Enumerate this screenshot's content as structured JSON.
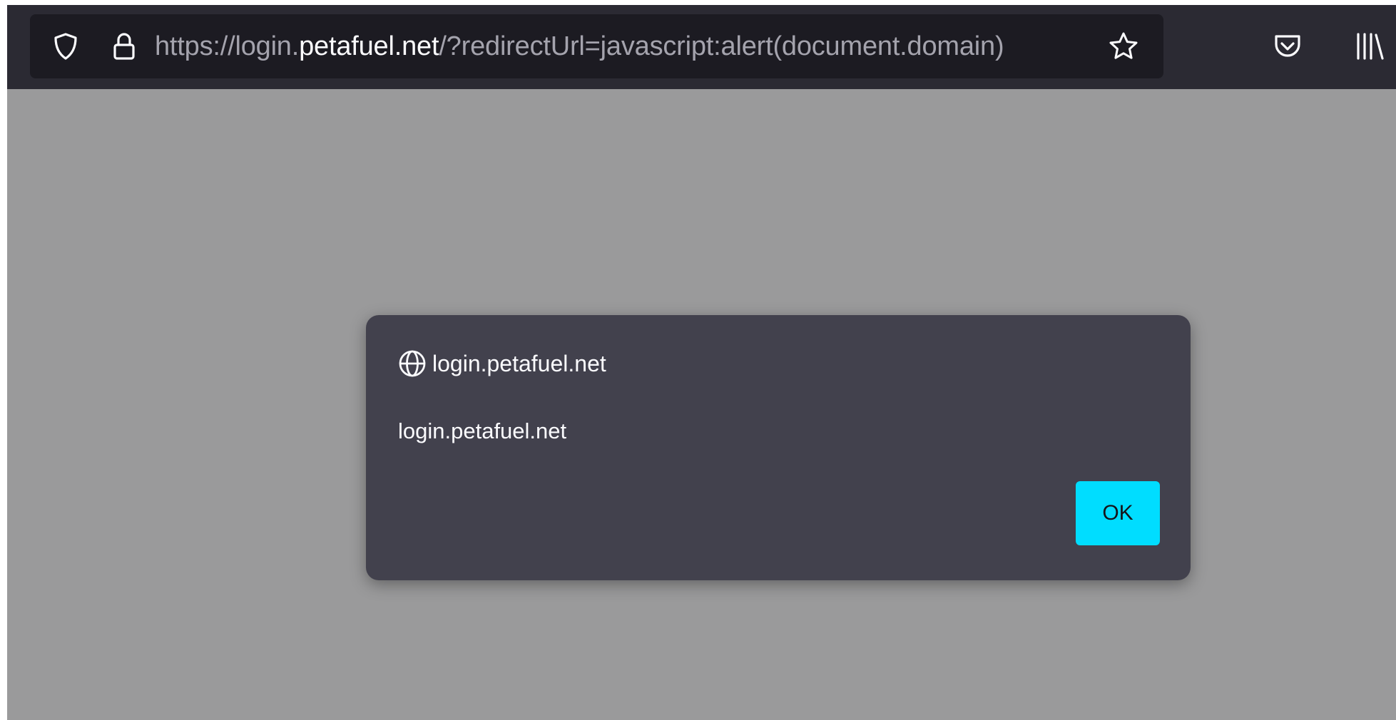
{
  "urlbar": {
    "url_prefix": "https://login.",
    "url_domain": "petafuel.net",
    "url_suffix": "/?redirectUrl=javascript:alert(document.domain)"
  },
  "icons": {
    "tracking_protection": "shield-icon",
    "connection_secure": "lock-icon",
    "bookmark": "star-icon",
    "pocket": "pocket-icon",
    "library": "library-icon",
    "dialog_origin": "globe-icon"
  },
  "dialog": {
    "origin": "login.petafuel.net",
    "message": "login.petafuel.net",
    "ok_label": "OK"
  },
  "colors": {
    "toolbar": "#2b2a33",
    "urlbar": "#1c1b22",
    "page_overlay": "#9a9a9b",
    "dialog": "#42414d",
    "accent_button": "#00ddff"
  }
}
